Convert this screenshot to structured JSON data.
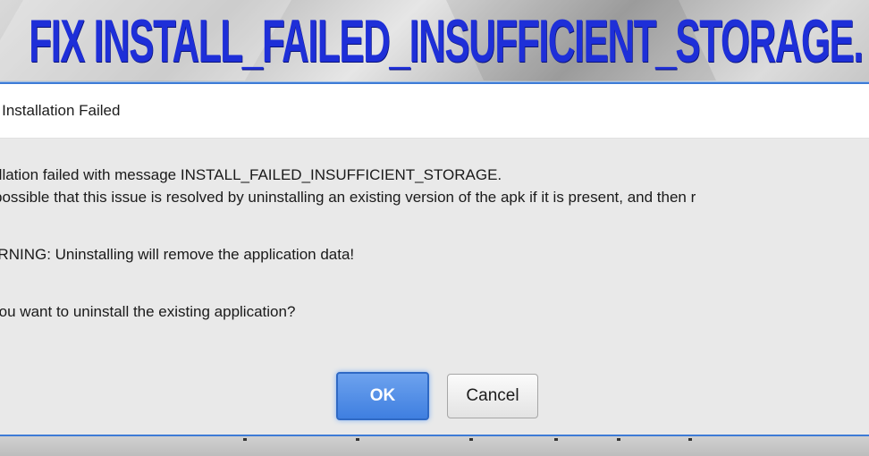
{
  "headline": "FIX  INSTALL_FAILED_INSUFFICIENT_STORAGE.",
  "dialog": {
    "title": "tion Installation Failed",
    "lines": [
      "stallation failed with message INSTALL_FAILED_INSUFFICIENT_STORAGE.",
      "is possible that this issue is resolved by uninstalling an existing version of the apk if it is present, and then r",
      "VARNING: Uninstalling will remove the application data!",
      "o you want to uninstall the existing application?"
    ],
    "ok_label": "OK",
    "cancel_label": "Cancel"
  },
  "colors": {
    "headline": "#1e2fd8",
    "dialog_border": "#3d7bd6",
    "ok_button": "#3f7fe0"
  }
}
